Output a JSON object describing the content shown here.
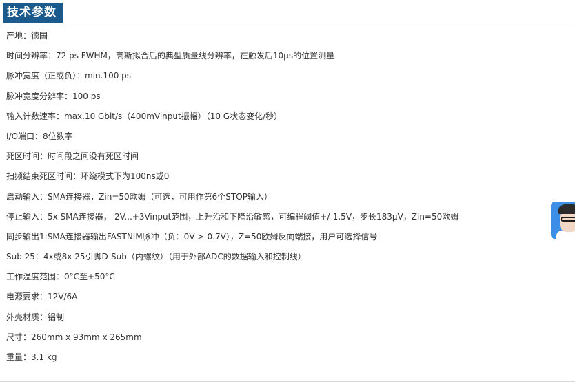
{
  "section": {
    "title": "技术参数"
  },
  "specs": [
    "产地：德国",
    "时间分辨率：72 ps FWHM，高斯拟合后的典型质量线分辨率，在触发后10µs的位置测量",
    "脉冲宽度（正或负）：min.100 ps",
    "脉冲宽度分辨率：100 ps",
    "输入计数速率：max.10 Gbit/s（400mVinput振幅）（10 G状态变化/秒）",
    "I/O端口：8位数字",
    "死区时间：时间段之间没有死区时间",
    "扫频结束死区时间：环绕模式下为100ns或0",
    "启动输入：SMA连接器，Zin=50欧姆（可选，可用作第6个STOP输入）",
    "停止输入：5x SMA连接器，-2V...+3Vinput范围，上升沿和下降沿敏感，可编程阈值+/-1.5V，步长183µV，Zin=50欧姆",
    "同步输出1:SMA连接器输出FASTNIM脉冲（负：0V->-0.7V），Z=50欧姆反向端接，用户可选择信号",
    "Sub 25：4x或8x 25引脚D-Sub（内螺纹）（用于外部ADC的数据输入和控制线）",
    "工作温度范围：0°C至+50°C",
    "电源要求：12V/6A",
    "外壳材质：铝制",
    "尺寸：260mm x 93mm x 265mm",
    "重量：3.1 kg"
  ],
  "widget": {
    "icon": "customer-service-avatar-icon",
    "accent": "#3d8ee6"
  },
  "colors": {
    "title_bg": "#1a5a8c",
    "title_fg": "#ffffff",
    "text": "#333333"
  }
}
